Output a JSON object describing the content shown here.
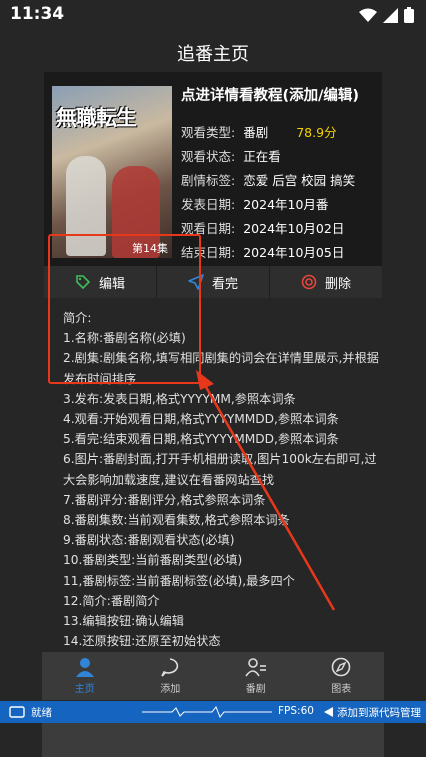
{
  "status_bar": {
    "time": "11:34"
  },
  "page": {
    "title": "追番主页"
  },
  "card": {
    "cover_logo": "無職転生",
    "cover_episode": "第14集",
    "headline": "点进详情看教程(添加/编辑)",
    "rows": [
      {
        "key": "观看类型:",
        "value": "番剧",
        "score": "78.9分"
      },
      {
        "key": "观看状态:",
        "value": "正在看"
      },
      {
        "key": "剧情标签:",
        "value": "恋爱 后宫 校园 搞笑"
      },
      {
        "key": "发表日期:",
        "value": "2024年10月番"
      },
      {
        "key": "观看日期:",
        "value": "2024年10月02日"
      },
      {
        "key": "结束日期:",
        "value": "2024年10月05日"
      }
    ]
  },
  "actions": {
    "edit": "编辑",
    "finish": "看完",
    "delete": "删除",
    "colors": {
      "edit": "#3fbf5a",
      "finish": "#2f86d8",
      "delete": "#e8453c"
    }
  },
  "intro": {
    "lines": [
      "简介:",
      "1.名称:番剧名称(必填)",
      "2.剧集:剧集名称,填写相同剧集的词会在详情里展示,并根据发布时间排序",
      "3.发布:发表日期,格式YYYYMM,参照本词条",
      "4.观看:开始观看日期,格式YYYYMMDD,参照本词条",
      "5.看完:结束观看日期,格式YYYYMMDD,参照本词条",
      "6.图片:番剧封面,打开手机相册读取,图片100k左右即可,过大会影响加载速度,建议在看番网站查找",
      "7.番剧评分:番剧评分,格式参照本词条",
      "8.番剧集数:当前观看集数,格式参照本词条",
      "9.番剧状态:番剧观看状态(必填)",
      "10.番剧类型:当前番剧类型(必填)",
      "11,番剧标签:当前番剧标签(必填),最多四个",
      "12.简介:番剧简介",
      "13.编辑按钮:确认编辑",
      "14.还原按钮:还原至初始状态"
    ]
  },
  "tabbar": {
    "items": [
      {
        "label": "主页",
        "icon": "person-icon"
      },
      {
        "label": "添加",
        "icon": "chat-bubble-icon"
      },
      {
        "label": "番剧",
        "icon": "list-person-icon"
      },
      {
        "label": "图表",
        "icon": "compass-icon"
      }
    ],
    "active_color": "#2f86d8"
  },
  "devbar": {
    "left": "就绪",
    "fps": "FPS:60",
    "right": "添加到源代码管理"
  },
  "annotation": {
    "color": "#e8381c"
  }
}
